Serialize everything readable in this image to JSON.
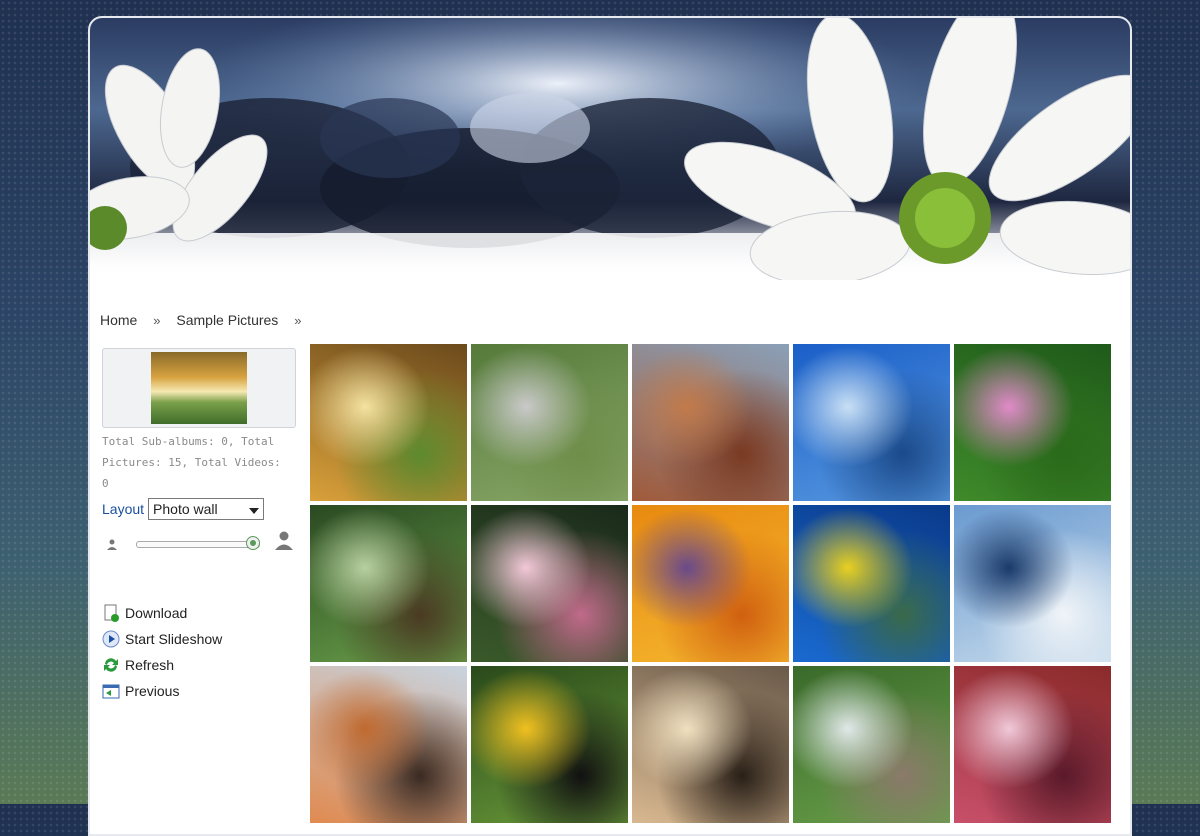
{
  "breadcrumb": {
    "items": [
      "Home",
      "Sample Pictures"
    ],
    "separator": "»"
  },
  "sidebar": {
    "stats_line1": "Total Sub-albums: 0, Total",
    "stats_line2": "Pictures: 15, Total Videos: 0",
    "layout_label": "Layout",
    "layout_value": "Photo wall",
    "slider_level": 1.0,
    "actions": [
      {
        "label": "Download",
        "icon": "download-icon"
      },
      {
        "label": "Start Slideshow",
        "icon": "play-icon"
      },
      {
        "label": "Refresh",
        "icon": "refresh-icon"
      },
      {
        "label": "Previous",
        "icon": "previous-icon"
      }
    ]
  },
  "photos": [
    {
      "subject": "autumn-tree",
      "colors": [
        "#6b4a1c",
        "#d9a03a",
        "#f4e2a0",
        "#5d8a2e"
      ]
    },
    {
      "subject": "stream-meadow",
      "colors": [
        "#557a3a",
        "#8aa86a",
        "#c9c9c9",
        "#6f8e4a"
      ]
    },
    {
      "subject": "desert-butte",
      "colors": [
        "#8aa0b8",
        "#a05a3a",
        "#c27a4a",
        "#7a3a22"
      ]
    },
    {
      "subject": "pier-sea",
      "colors": [
        "#1a5fc8",
        "#5a9ae0",
        "#c8dff5",
        "#1b4a8a"
      ]
    },
    {
      "subject": "pink-flowers",
      "colors": [
        "#1f5a1a",
        "#3f8a2a",
        "#e08ac8",
        "#2a6a1a"
      ]
    },
    {
      "subject": "forest-path",
      "colors": [
        "#2a4a22",
        "#6aa04a",
        "#b8d0a0",
        "#4a3a22"
      ]
    },
    {
      "subject": "frangipani",
      "colors": [
        "#1a2a1a",
        "#3a5a2a",
        "#f2c8d8",
        "#c06a8a"
      ]
    },
    {
      "subject": "orange-daisies",
      "colors": [
        "#e88a10",
        "#f5b830",
        "#6a4a8a",
        "#d06010"
      ]
    },
    {
      "subject": "sea-turtle",
      "colors": [
        "#0a3a8a",
        "#1a6ad0",
        "#e8d020",
        "#3a6a4a"
      ]
    },
    {
      "subject": "whale-tail",
      "colors": [
        "#6a9ad0",
        "#c8dcec",
        "#1a3a6a",
        "#f0f4f8"
      ]
    },
    {
      "subject": "desert-oryx",
      "colors": [
        "#c8d4e0",
        "#e08a50",
        "#c06a30",
        "#3a2a22"
      ]
    },
    {
      "subject": "toucan",
      "colors": [
        "#2a4a1a",
        "#6a9a3a",
        "#f0c020",
        "#111111"
      ]
    },
    {
      "subject": "savanna-trees",
      "colors": [
        "#6a5a4a",
        "#d8b890",
        "#f0e0c0",
        "#2a2018"
      ]
    },
    {
      "subject": "waterfall-garden",
      "colors": [
        "#3a6a2a",
        "#6aa04a",
        "#e0e8e8",
        "#8a7a6a"
      ]
    },
    {
      "subject": "frosted-leaves",
      "colors": [
        "#8a2a2a",
        "#c8506a",
        "#f0c8d8",
        "#5a1a2a"
      ]
    }
  ]
}
